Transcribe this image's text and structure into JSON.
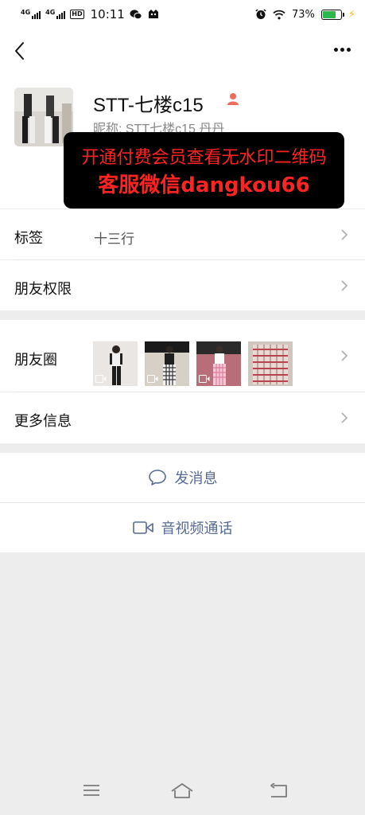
{
  "status_bar": {
    "net1": "4G",
    "net2": "4G",
    "hd": "HD",
    "time": "10:11",
    "battery_pct": "73%",
    "battery_level": 0.73,
    "battery_color": "#2db84d",
    "icons": [
      "wechat-icon",
      "notification-icon",
      "alarm-icon",
      "wifi-icon",
      "battery-icon",
      "charging-icon"
    ]
  },
  "profile": {
    "name": "STT-七楼c15",
    "nickname": "昵称: STT七楼c15 丹丹",
    "watermark_line1": "开通付费会员查看无水印二维码",
    "watermark_line2": "客服微信dangkou66"
  },
  "rows": {
    "tags_label": "标签",
    "tags_value": "十三行",
    "permissions_label": "朋友权限",
    "moments_label": "朋友圈",
    "more_info_label": "更多信息"
  },
  "actions": {
    "send_message": "发消息",
    "av_call": "音视频通话"
  },
  "colors": {
    "link": "#576b95",
    "watermark_text": "#ff2323",
    "background": "#ededed"
  }
}
